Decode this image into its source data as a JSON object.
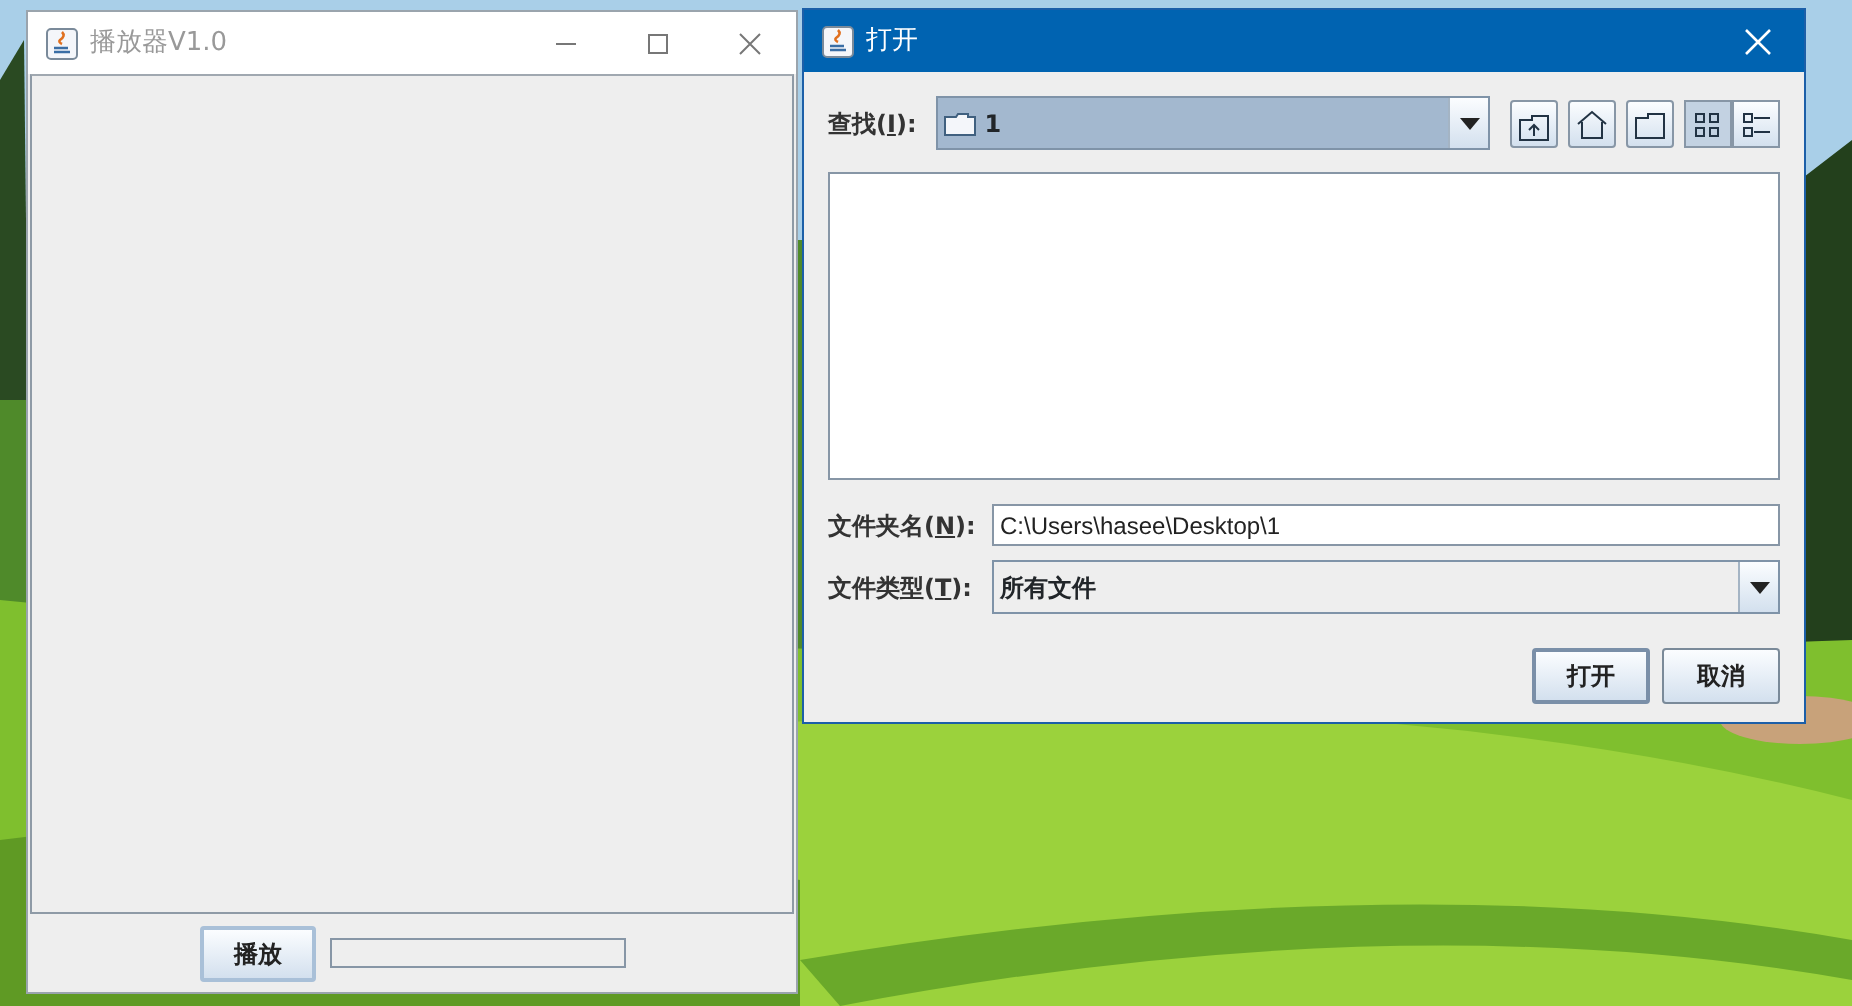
{
  "player": {
    "title": "播放器V1.0",
    "play_button": "播放",
    "progress": {
      "level": 0
    }
  },
  "dialog": {
    "title": "打开",
    "look_in": {
      "label_before": "查找(",
      "mnemonic": "I",
      "label_after": "):",
      "value": "1"
    },
    "toolbar": [
      {
        "kind": "up",
        "selected": false
      },
      {
        "kind": "home",
        "selected": false
      },
      {
        "kind": "new-folder",
        "selected": false
      },
      {
        "kind": "list",
        "selected": true
      },
      {
        "kind": "details",
        "selected": false
      }
    ],
    "folder_name": {
      "label_before": "文件夹名(",
      "mnemonic": "N",
      "label_after": "):",
      "value": "C:\\Users\\hasee\\Desktop\\1"
    },
    "file_type": {
      "label_before": "文件类型(",
      "mnemonic": "T",
      "label_after": "):",
      "value": "所有文件"
    },
    "buttons": [
      {
        "label": "打开",
        "default": true
      },
      {
        "label": "取消",
        "default": false
      }
    ]
  }
}
